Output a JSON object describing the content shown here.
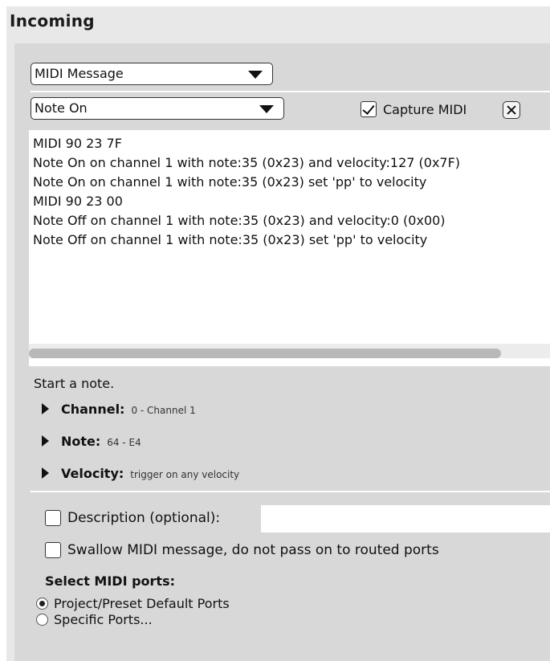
{
  "panel": {
    "title": "Incoming"
  },
  "message_type": {
    "selected": "MIDI Message"
  },
  "message_subtype": {
    "selected": "Note On"
  },
  "capture": {
    "label": "Capture MIDI",
    "checked": true
  },
  "log": {
    "lines": [
      "MIDI 90 23 7F",
      "Note On on channel 1 with note:35 (0x23) and velocity:127 (0x7F)",
      "Note On on channel 1 with note:35 (0x23) set 'pp' to velocity",
      "MIDI 90 23 00",
      "Note Off on channel 1 with note:35 (0x23) and velocity:0 (0x00)",
      "Note Off on channel 1 with note:35 (0x23) set 'pp' to velocity"
    ]
  },
  "description_text": "Start a note.",
  "properties": [
    {
      "name": "Channel:",
      "value": "0 - Channel 1"
    },
    {
      "name": "Note:",
      "value": "64 - E4"
    },
    {
      "name": "Velocity:",
      "value": "trigger on any velocity"
    }
  ],
  "options": {
    "description_label": "Description (optional):",
    "description_value": "",
    "swallow_label": "Swallow MIDI message, do not pass on to routed ports"
  },
  "ports": {
    "label": "Select MIDI ports:",
    "choices": [
      {
        "label": "Project/Preset Default Ports",
        "selected": true
      },
      {
        "label": "Specific Ports...",
        "selected": false
      }
    ]
  }
}
